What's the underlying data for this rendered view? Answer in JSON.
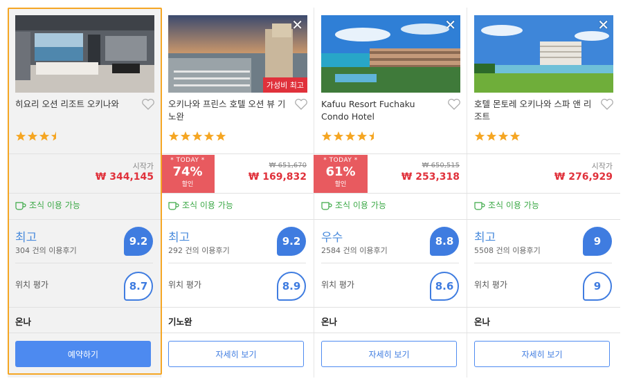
{
  "colors": {
    "accent": "#4d8af0",
    "price_red": "#e0313b",
    "breakfast_green": "#3aa845",
    "selected_border": "#f5a623",
    "star": "#f5a623"
  },
  "hotels": [
    {
      "name": "히요리 오션 리조트 오키나와",
      "image": "hotel-room-ocean-view",
      "closable": false,
      "badge": "",
      "stars": 3.5,
      "start_label": "시작가",
      "price": "₩ 344,145",
      "discount": null,
      "breakfast": "조식 이용 가능",
      "rating_word": "최고",
      "reviews": "304 건의 이용후기",
      "score": "9.2",
      "location_label": "위치 평가",
      "location_score": "8.7",
      "area": "온나",
      "button": "예약하기"
    },
    {
      "name": "오키나와 프린스 호텔 오션 뷰 기노완",
      "image": "hotel-marina-sunset",
      "closable": true,
      "badge": "가성비 최고",
      "stars": 5,
      "start_label": "",
      "price": "₩ 169,832",
      "discount": {
        "today": "* TODAY *",
        "percent": "74%",
        "label": "할인",
        "original": "₩ 651,670"
      },
      "breakfast": "조식 이용 가능",
      "rating_word": "최고",
      "reviews": "292 건의 이용후기",
      "score": "9.2",
      "location_label": "위치 평가",
      "location_score": "8.9",
      "area": "기노완",
      "button": "자세히 보기"
    },
    {
      "name": "Kafuu Resort Fuchaku Condo Hotel",
      "image": "hotel-resort-coast",
      "closable": true,
      "badge": "",
      "stars": 4.5,
      "start_label": "",
      "price": "₩ 253,318",
      "discount": {
        "today": "* TODAY *",
        "percent": "61%",
        "label": "할인",
        "original": "₩ 650,515"
      },
      "breakfast": "조식 이용 가능",
      "rating_word": "우수",
      "reviews": "2584 건의 이용후기",
      "score": "8.8",
      "location_label": "위치 평가",
      "location_score": "8.6",
      "area": "온나",
      "button": "자세히 보기"
    },
    {
      "name": "호텔 몬토레 오키나와 스파 앤 리조트",
      "image": "hotel-beach-lawn",
      "closable": true,
      "badge": "",
      "stars": 4,
      "start_label": "시작가",
      "price": "₩ 276,929",
      "discount": null,
      "breakfast": "조식 이용 가능",
      "rating_word": "최고",
      "reviews": "5508 건의 이용후기",
      "score": "9",
      "location_label": "위치 평가",
      "location_score": "9",
      "area": "온나",
      "button": "자세히 보기"
    }
  ]
}
